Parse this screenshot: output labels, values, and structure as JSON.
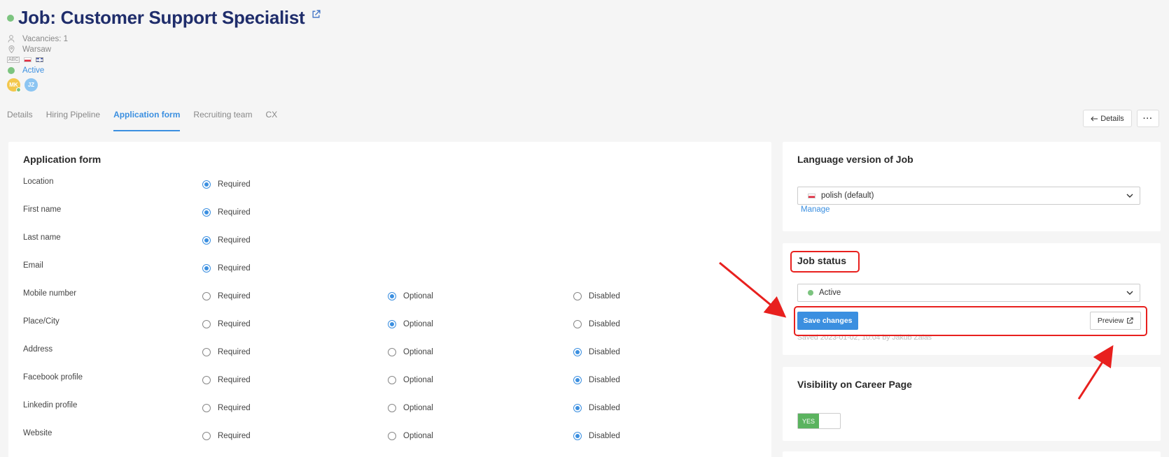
{
  "header": {
    "title": "Job: Customer Support Specialist",
    "vacancies": "Vacancies: 1",
    "location": "Warsaw",
    "abc": "ABC",
    "status": "Active",
    "avatars": [
      "MK",
      "JZ"
    ]
  },
  "tabs": [
    "Details",
    "Hiring Pipeline",
    "Application form",
    "Recruiting team",
    "CX"
  ],
  "top_buttons": {
    "details": "Details",
    "more": "···"
  },
  "form": {
    "title": "Application form",
    "options": [
      "Required",
      "Optional",
      "Disabled"
    ],
    "fields": [
      {
        "label": "Location",
        "selected": "Required",
        "only_required": true
      },
      {
        "label": "First name",
        "selected": "Required",
        "only_required": true
      },
      {
        "label": "Last name",
        "selected": "Required",
        "only_required": true
      },
      {
        "label": "Email",
        "selected": "Required",
        "only_required": true
      },
      {
        "label": "Mobile number",
        "selected": "Optional",
        "only_required": false
      },
      {
        "label": "Place/City",
        "selected": "Optional",
        "only_required": false
      },
      {
        "label": "Address",
        "selected": "Disabled",
        "only_required": false
      },
      {
        "label": "Facebook profile",
        "selected": "Disabled",
        "only_required": false
      },
      {
        "label": "Linkedin profile",
        "selected": "Disabled",
        "only_required": false
      },
      {
        "label": "Website",
        "selected": "Disabled",
        "only_required": false
      }
    ]
  },
  "language": {
    "title": "Language version of Job",
    "selected": "polish (default)",
    "manage": "Manage"
  },
  "job_status": {
    "title": "Job status",
    "selected": "Active",
    "save": "Save changes",
    "preview": "Preview",
    "saved": "Saved 2023-01-02, 10:04 by Jakub Zalas"
  },
  "visibility": {
    "title": "Visibility on Career Page",
    "toggle": "YES"
  },
  "colors": {
    "accent": "#3b8fe0",
    "active": "#7cc47f",
    "title": "#1f2d6b",
    "annotation": "#e8201e"
  }
}
